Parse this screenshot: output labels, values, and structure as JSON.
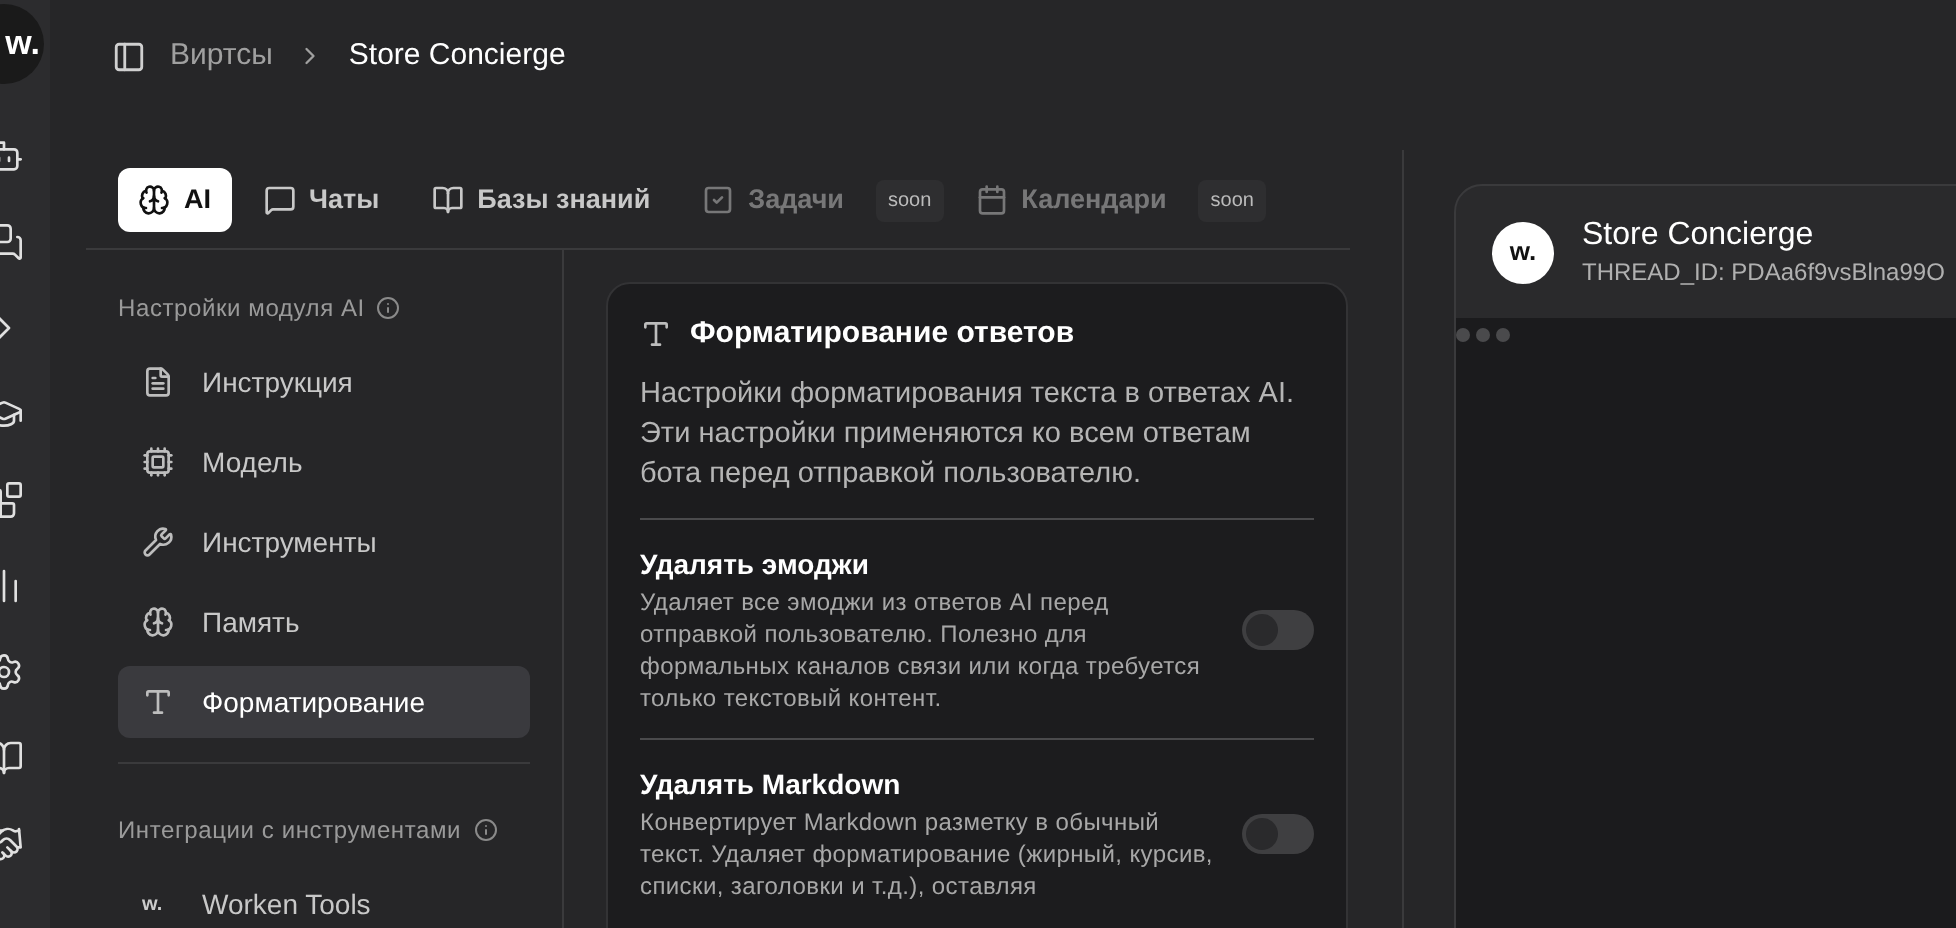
{
  "rail": {
    "logo": "w."
  },
  "breadcrumb": [
    "Виртсы",
    "Store Concierge"
  ],
  "tabs": [
    {
      "label": "AI",
      "selected": true,
      "disabled": false
    },
    {
      "label": "Чаты",
      "selected": false,
      "disabled": false
    },
    {
      "label": "Базы знаний",
      "selected": false,
      "disabled": false
    },
    {
      "label": "Задачи",
      "selected": false,
      "disabled": true,
      "badge": "soon"
    },
    {
      "label": "Календари",
      "selected": false,
      "disabled": true,
      "badge": "soon"
    }
  ],
  "sidebar": [
    {
      "title": "Настройки модуля AI",
      "items": [
        {
          "label": "Инструкция",
          "selected": false
        },
        {
          "label": "Модель",
          "selected": false
        },
        {
          "label": "Инструменты",
          "selected": false
        },
        {
          "label": "Память",
          "selected": false
        },
        {
          "label": "Форматирование",
          "selected": true
        }
      ]
    },
    {
      "title": "Интеграции с инструментами",
      "items": [
        {
          "label": "Worken Tools",
          "selected": false,
          "logo": "w."
        }
      ]
    }
  ],
  "panel": {
    "title": "Форматирование ответов",
    "description": "Настройки форматирования текста в ответах AI. Эти настройки применяются ко всем ответам бота перед отправкой пользователю.",
    "settings": [
      {
        "title": "Удалять эмоджи",
        "description": "Удаляет все эмоджи из ответов AI перед отправкой пользователю. Полезно для формальных каналов связи или когда требуется только текстовый контент.",
        "on": false
      },
      {
        "title": "Удалять Markdown",
        "description": "Конвертирует Markdown разметку в обычный текст. Удаляет форматирование (жирный, курсив, списки, заголовки и т.д.), оставляя",
        "on": false
      }
    ]
  },
  "chat": {
    "avatar": "w.",
    "title": "Store Concierge",
    "thread_id": "THREAD_ID: PDAa6f9vsBlna99O"
  }
}
